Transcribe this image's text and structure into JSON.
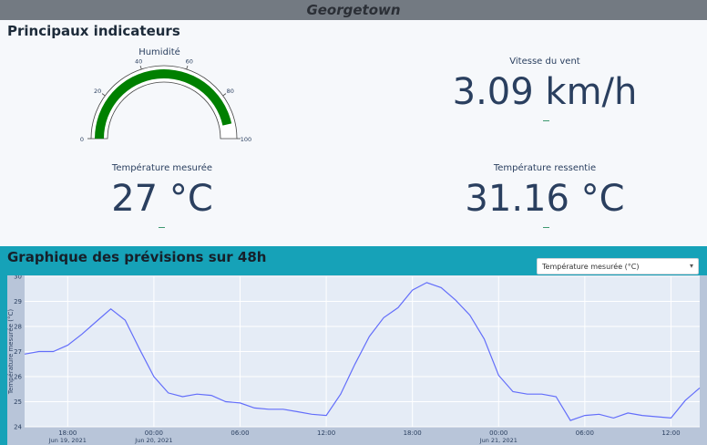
{
  "header": {
    "city": "Georgetown"
  },
  "indicators": {
    "title": "Principaux indicateurs",
    "humidity": {
      "label": "Humidité",
      "value": 93,
      "ticks": [
        "0",
        "20",
        "40",
        "60",
        "80",
        "100"
      ],
      "bar_color": "#008000"
    },
    "wind": {
      "label": "Vitesse du vent",
      "value": "3.09 km/h"
    },
    "temp_measured": {
      "label": "Température mesurée",
      "value": "27 °C"
    },
    "temp_felt": {
      "label": "Température ressentie",
      "value": "31.16 °C"
    }
  },
  "forecast": {
    "title": "Graphique des prévisions sur 48h",
    "selector": {
      "selected": "Température mesurée (°C)"
    }
  },
  "chart_data": {
    "type": "line",
    "ylabel": "Température mesurée (°C)",
    "ylim": [
      24,
      30
    ],
    "yticks": [
      "24",
      "25",
      "26",
      "27",
      "28",
      "29",
      "30"
    ],
    "xticks": [
      {
        "label": "18:00",
        "sub": "Jun 19, 2021",
        "t": 18
      },
      {
        "label": "00:00",
        "sub": "Jun 20, 2021",
        "t": 24
      },
      {
        "label": "06:00",
        "sub": "",
        "t": 30
      },
      {
        "label": "12:00",
        "sub": "",
        "t": 36
      },
      {
        "label": "18:00",
        "sub": "",
        "t": 42
      },
      {
        "label": "00:00",
        "sub": "Jun 21, 2021",
        "t": 48
      },
      {
        "label": "06:00",
        "sub": "",
        "t": 54
      },
      {
        "label": "12:00",
        "sub": "",
        "t": 60
      }
    ],
    "xlim": [
      15,
      62
    ],
    "line_color": "#636efa",
    "series": [
      {
        "x": [
          15,
          16,
          17,
          18,
          19,
          20,
          21,
          22,
          23,
          24,
          25,
          26,
          27,
          28,
          29,
          30,
          31,
          32,
          33,
          34,
          35,
          36,
          37,
          38,
          39,
          40,
          41,
          42,
          43,
          44,
          45,
          46,
          47,
          48,
          49,
          50,
          51,
          52,
          53,
          54,
          55,
          56,
          57,
          58,
          59,
          60,
          61,
          62
        ],
        "y": [
          26.9,
          27.0,
          27.0,
          27.25,
          27.7,
          28.2,
          28.7,
          28.25,
          27.1,
          26.0,
          25.35,
          25.2,
          25.3,
          25.25,
          25.0,
          24.95,
          24.75,
          24.7,
          24.7,
          24.6,
          24.5,
          24.45,
          25.3,
          26.5,
          27.6,
          28.35,
          28.75,
          29.45,
          29.75,
          29.55,
          29.05,
          28.45,
          27.5,
          26.05,
          25.4,
          25.3,
          25.3,
          25.2,
          24.25,
          24.45,
          24.5,
          24.35,
          24.55,
          24.45,
          24.4,
          24.35,
          25.05,
          25.55
        ]
      }
    ]
  }
}
